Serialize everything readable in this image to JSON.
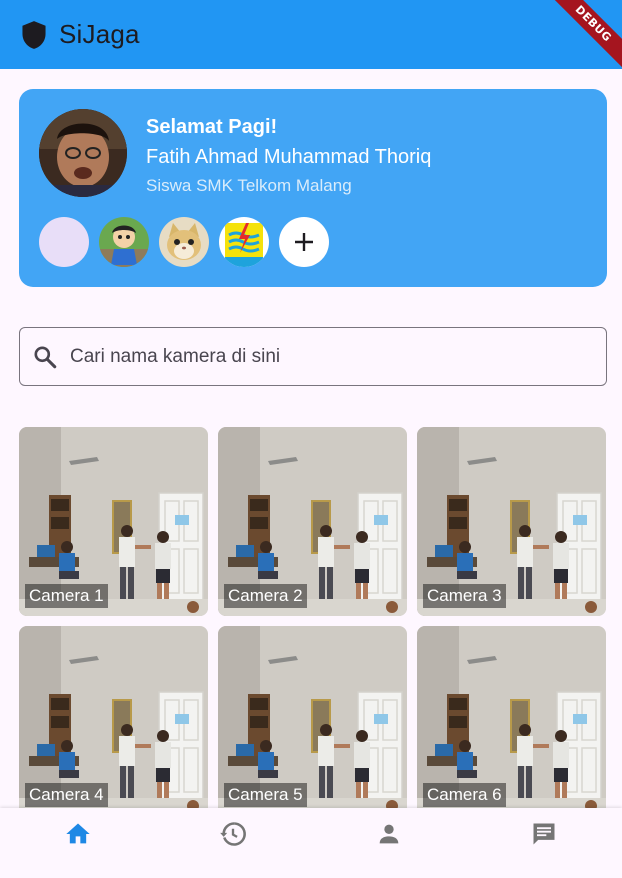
{
  "app": {
    "title": "SiJaga",
    "debug_label": "DEBUG",
    "bar_color": "#2196f3"
  },
  "profile": {
    "greeting": "Selamat Pagi!",
    "name": "Fatih Ahmad Muhammad Thoriq",
    "role": "Siswa SMK Telkom Malang",
    "card_color": "#42a5f5",
    "circles": [
      {
        "type": "empty",
        "color": "#e8def8"
      },
      {
        "type": "cartoon-avatar"
      },
      {
        "type": "cat-avatar"
      },
      {
        "type": "pln-logo-avatar"
      },
      {
        "type": "add",
        "icon": "plus-icon"
      }
    ]
  },
  "search": {
    "placeholder": "Cari nama kamera di sini",
    "value": "",
    "icon": "search-icon"
  },
  "cameras": [
    {
      "label": "Camera 1"
    },
    {
      "label": "Camera 2"
    },
    {
      "label": "Camera 3"
    },
    {
      "label": "Camera 4"
    },
    {
      "label": "Camera 5"
    },
    {
      "label": "Camera 6"
    }
  ],
  "bottom_nav": {
    "items": [
      {
        "icon": "home-icon",
        "active": true,
        "color": "#1e88e5"
      },
      {
        "icon": "history-icon",
        "active": false,
        "color": "#757575"
      },
      {
        "icon": "person-icon",
        "active": false,
        "color": "#757575"
      },
      {
        "icon": "chat-icon",
        "active": false,
        "color": "#757575"
      }
    ]
  }
}
